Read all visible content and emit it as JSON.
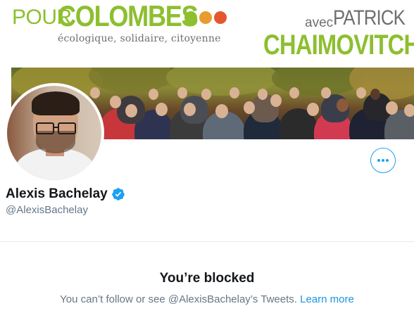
{
  "banner": {
    "pour": "POUR",
    "colombes": "COLOMBES",
    "tagline": "écologique, solidaire, citoyenne",
    "avec": "avec",
    "patrick": "PATRICK",
    "chaimovitch": "CHAIMOVITCH",
    "colors": {
      "green": "#8dbf2f",
      "grey": "#6f6f6f"
    }
  },
  "profile": {
    "name": "Alexis Bachelay",
    "handle": "@AlexisBachelay",
    "verified_icon": "verified-badge-icon",
    "more_icon": "more-icon"
  },
  "blocked": {
    "title": "You’re blocked",
    "message": "You can’t follow or see @AlexisBachelay’s Tweets.",
    "link": "Learn more"
  },
  "colors": {
    "accent": "#1da1f2",
    "text": "#14171a",
    "muted": "#657786"
  }
}
